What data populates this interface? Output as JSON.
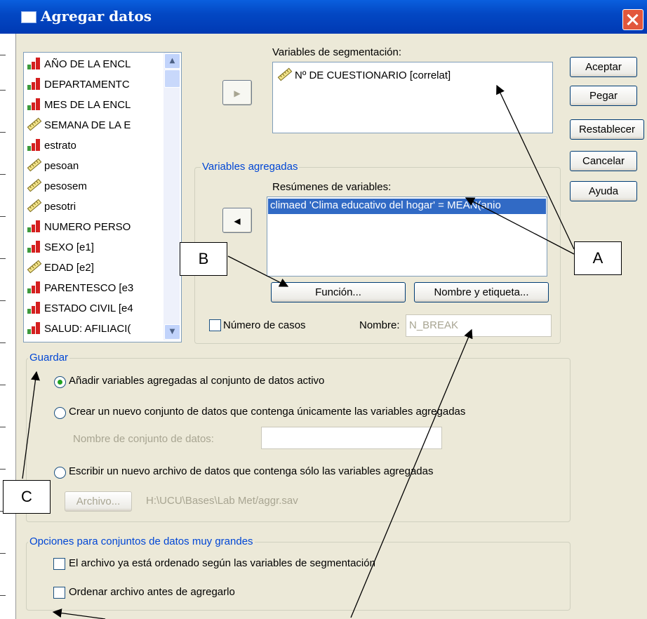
{
  "window": {
    "title": "Agregar datos"
  },
  "source_variables": [
    {
      "label": "AÑO DE LA ENCL",
      "icon": "nominal-icon"
    },
    {
      "label": "DEPARTAMENTC",
      "icon": "nominal-icon"
    },
    {
      "label": "MES DE LA ENCL",
      "icon": "nominal-icon"
    },
    {
      "label": "SEMANA DE LA E",
      "icon": "scale-icon"
    },
    {
      "label": "estrato",
      "icon": "nominal-icon"
    },
    {
      "label": "pesoan",
      "icon": "scale-icon"
    },
    {
      "label": "pesosem",
      "icon": "scale-icon"
    },
    {
      "label": "pesotri",
      "icon": "scale-icon"
    },
    {
      "label": "NUMERO PERSO",
      "icon": "nominal-icon"
    },
    {
      "label": "SEXO [e1]",
      "icon": "nominal-icon"
    },
    {
      "label": "EDAD [e2]",
      "icon": "scale-icon"
    },
    {
      "label": "PARENTESCO [e3",
      "icon": "nominal-icon"
    },
    {
      "label": "ESTADO CIVIL [e4",
      "icon": "nominal-icon"
    },
    {
      "label": "SALUD: AFILIACI(",
      "icon": "nominal-icon"
    }
  ],
  "segmentation": {
    "label": "Variables de segmentación:",
    "items": [
      "Nº DE CUESTIONARIO [correlat]"
    ]
  },
  "aggregated": {
    "group_label": "Variables agregadas",
    "summaries_label": "Resúmenes de variables:",
    "items": [
      "climaed 'Clima educativo del hogar' = MEAN(anio"
    ],
    "function_button": "Función...",
    "name_label_button": "Nombre y etiqueta...",
    "num_cases_label": "Número de casos",
    "name_label": "Nombre:",
    "name_value": "N_BREAK"
  },
  "buttons": {
    "ok": "Aceptar",
    "paste": "Pegar",
    "reset": "Restablecer",
    "cancel": "Cancelar",
    "help": "Ayuda"
  },
  "save": {
    "group_label": "Guardar",
    "option_add": "Añadir variables agregadas al conjunto de datos activo",
    "option_new_dataset": "Crear un nuevo conjunto de datos que contenga únicamente las variables agregadas",
    "dataset_name_label": "Nombre de conjunto de datos:",
    "option_write_file": "Escribir un nuevo archivo de datos que contenga sólo las variables agregadas",
    "file_button": "Archivo...",
    "file_path": "H:\\UCU\\Bases\\Lab Met/aggr.sav",
    "selected": "option_add"
  },
  "large": {
    "group_label": "Opciones para conjuntos de datos muy grandes",
    "sorted_label": "El archivo ya está ordenado según las variables de segmentación",
    "sort_label": "Ordenar archivo antes de agregarlo"
  },
  "callouts": {
    "a": "A",
    "b": "B",
    "c": "C"
  },
  "colors": {
    "title_bar": "#0348c4",
    "selection": "#316ac5",
    "group_label": "#0046d5"
  }
}
